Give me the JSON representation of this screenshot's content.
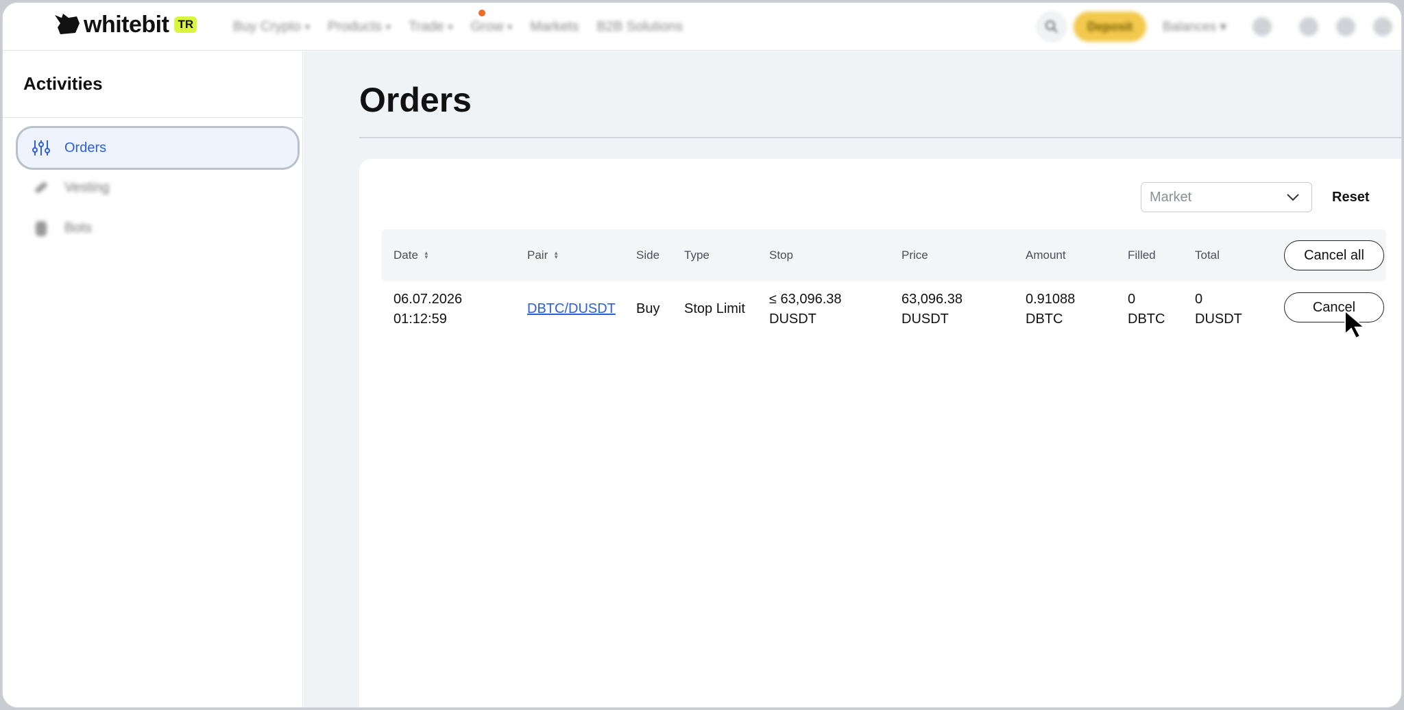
{
  "header": {
    "brand": "whitebit",
    "brand_badge": "TR",
    "nav": [
      {
        "label": "Buy Crypto"
      },
      {
        "label": "Products"
      },
      {
        "label": "Trade"
      },
      {
        "label": "Grow"
      },
      {
        "label": "Markets"
      },
      {
        "label": "B2B Solutions"
      }
    ],
    "deposit_label": "Deposit",
    "balances_label": "Balances",
    "accent_color": "#d9f53d",
    "deposit_color": "#f2c94c"
  },
  "sidebar": {
    "title": "Activities",
    "items": [
      {
        "label": "Orders",
        "icon": "sliders-icon",
        "active": true
      },
      {
        "label": "Vesting",
        "icon": "link-icon",
        "active": false
      },
      {
        "label": "Bots",
        "icon": "bot-icon",
        "active": false
      }
    ],
    "active_color": "#2b5fd9"
  },
  "main": {
    "title": "Orders",
    "filter": {
      "market_placeholder": "Market",
      "reset_label": "Reset"
    },
    "table": {
      "columns": [
        "Date",
        "Pair",
        "Side",
        "Type",
        "Stop",
        "Price",
        "Amount",
        "Filled",
        "Total"
      ],
      "cancel_all_label": "Cancel all",
      "rows": [
        {
          "date": "06.07.2026",
          "time": "01:12:59",
          "pair": "DBTC/DUSDT",
          "side": "Buy",
          "type": "Stop Limit",
          "stop_value": "≤ 63,096.38",
          "stop_unit": "DUSDT",
          "price_value": "63,096.38",
          "price_unit": "DUSDT",
          "amount_value": "0.91088",
          "amount_unit": "DBTC",
          "filled_value": "0",
          "filled_unit": "DBTC",
          "total_value": "0",
          "total_unit": "DUSDT",
          "cancel_label": "Cancel"
        }
      ]
    }
  }
}
